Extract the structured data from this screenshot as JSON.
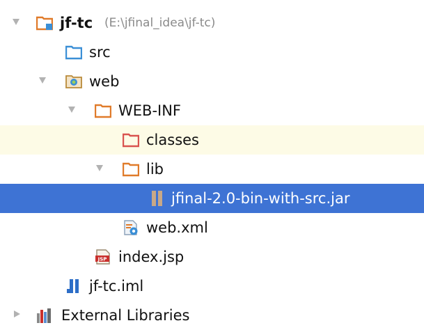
{
  "tree": {
    "root": {
      "label": "jf-tc",
      "path": "(E:\\jfinal_idea\\jf-tc)"
    },
    "src": {
      "label": "src"
    },
    "web": {
      "label": "web"
    },
    "web_inf": {
      "label": "WEB-INF"
    },
    "classes": {
      "label": "classes"
    },
    "lib": {
      "label": "lib"
    },
    "jar": {
      "label": "jfinal-2.0-bin-with-src.jar"
    },
    "web_xml": {
      "label": "web.xml"
    },
    "index_jsp": {
      "label": "index.jsp"
    },
    "iml": {
      "label": "jf-tc.iml"
    },
    "external": {
      "label": "External Libraries"
    }
  },
  "icons": {
    "module_folder": "module-folder-icon",
    "source_folder": "source-folder-icon",
    "web_folder": "web-folder-icon",
    "folder": "folder-icon",
    "excluded_folder": "excluded-folder-icon",
    "jar": "jar-icon",
    "xml_config": "web-xml-icon",
    "jsp": "jsp-icon",
    "iml": "iml-icon",
    "libraries": "libraries-icon"
  },
  "colors": {
    "selection": "#3e73d4",
    "highlight": "#fdfbe6",
    "folder_orange": "#e07b2a",
    "excluded_red": "#d9534f",
    "source_blue": "#3b8fd6",
    "path_gray": "#8a8a8a"
  }
}
